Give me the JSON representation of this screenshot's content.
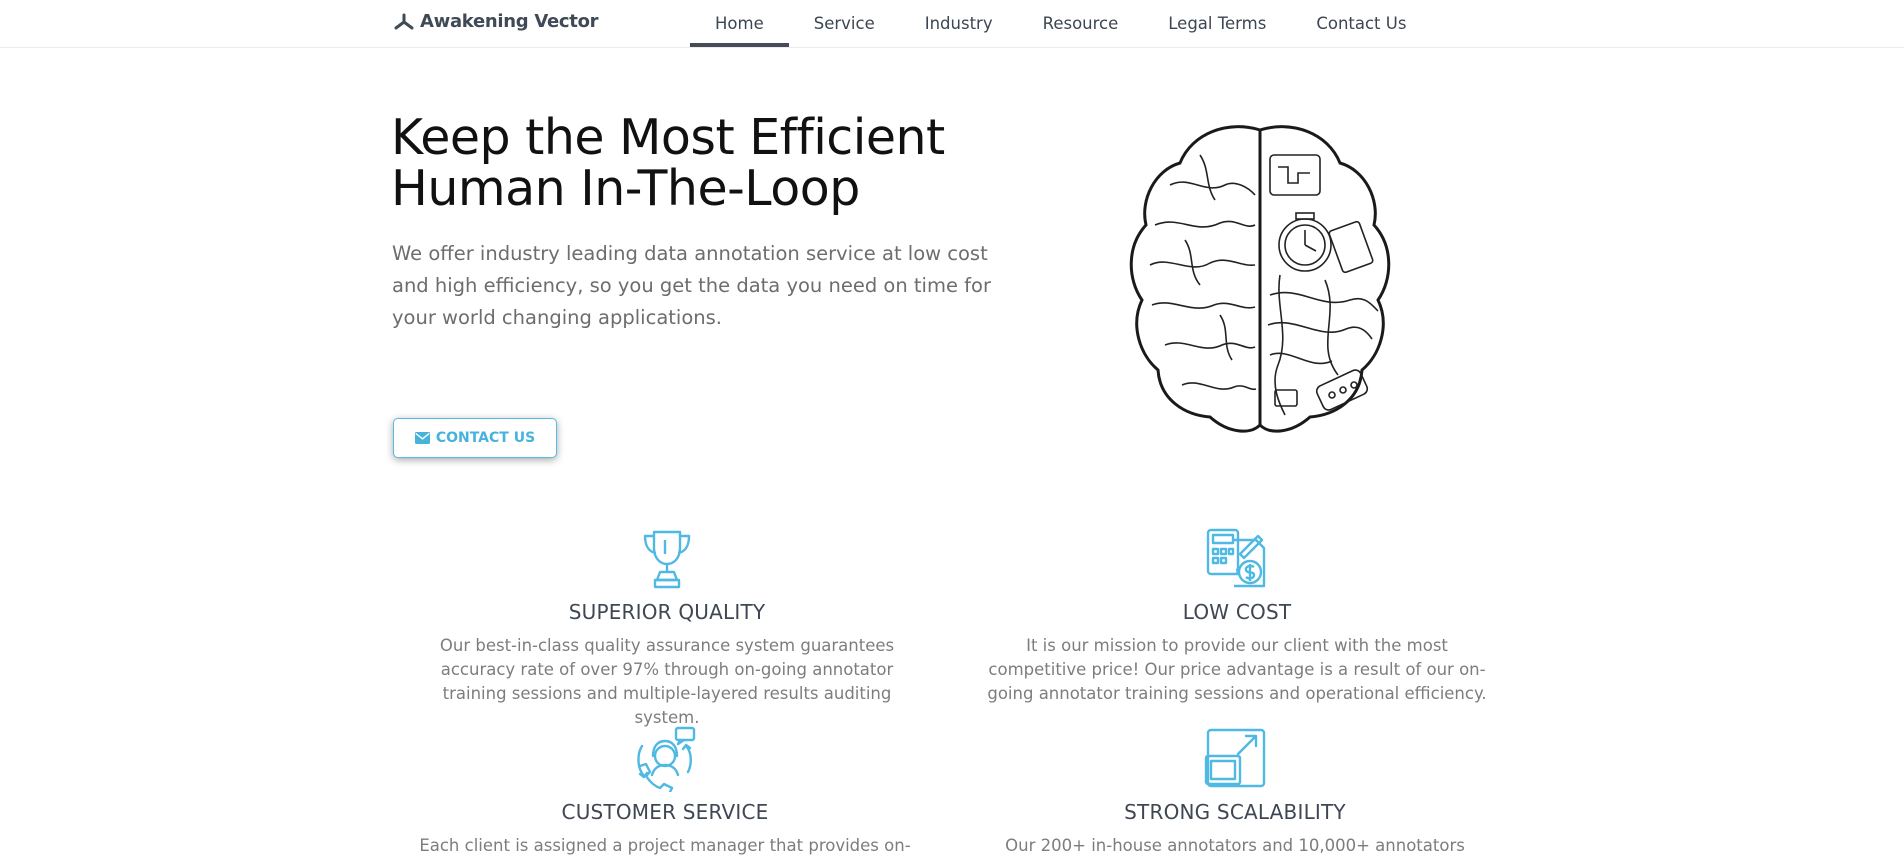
{
  "brand": {
    "name": "Awakening Vector"
  },
  "nav": {
    "items": [
      "Home",
      "Service",
      "Industry",
      "Resource",
      "Legal Terms",
      "Contact Us"
    ],
    "active": "Home"
  },
  "hero": {
    "title_line1": "Keep the Most Efficient",
    "title_line2": "Human In-The-Loop",
    "description": "We offer industry leading data annotation service at low cost and high efficiency, so you get the data you need on time for your world changing applications.",
    "cta_label": "CONTACT US",
    "cta_icon": "envelope-icon",
    "illustration": "brain-illustration"
  },
  "features": [
    {
      "icon": "trophy-icon",
      "title": "SUPERIOR QUALITY",
      "text": "Our best-in-class quality assurance system guarantees accuracy rate of over 97% through on-going annotator training sessions and multiple-layered results auditing system."
    },
    {
      "icon": "calculator-icon",
      "title": "LOW COST",
      "text": "It is our mission to provide our client with the most competitive price! Our price advantage is a result of our on-going annotator training sessions and operational efficiency."
    },
    {
      "icon": "customer-service-icon",
      "title": "CUSTOMER SERVICE",
      "text": "Each client is assigned a project manager that provides on-"
    },
    {
      "icon": "scale-up-icon",
      "title": "STRONG SCALABILITY",
      "text": "Our 200+ in-house annotators and 10,000+ annotators"
    }
  ],
  "colors": {
    "accent": "#4fb9e3",
    "text_dark": "#3e4752",
    "text_muted": "#7d7d7d",
    "nav_underline": "#444c55"
  }
}
